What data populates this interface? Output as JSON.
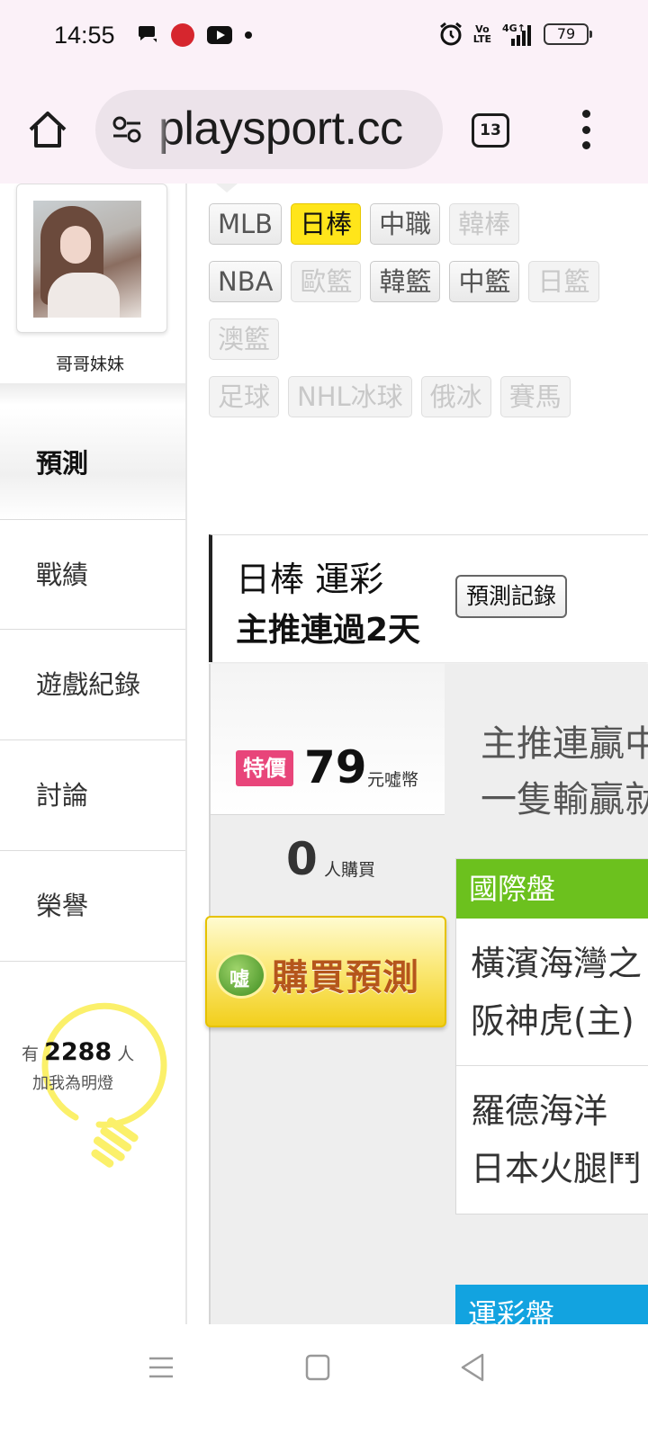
{
  "status_bar": {
    "time": "14:55",
    "battery": "79",
    "left_icons": [
      "chat-icon",
      "app-badge-icon",
      "youtube-icon",
      "notification-dot-icon"
    ],
    "right_icons": [
      "alarm-icon",
      "volte-icon",
      "signal-4g-icon",
      "battery-icon"
    ],
    "volte_top": "Vo",
    "volte_bottom": "LTE"
  },
  "browser": {
    "url": "playsport.cc",
    "tab_count": "13"
  },
  "sidebar": {
    "nickname": "哥哥妹妹",
    "nav": [
      {
        "label": "預測",
        "active": true
      },
      {
        "label": "戰績"
      },
      {
        "label": "遊戲紀錄"
      },
      {
        "label": "討論"
      },
      {
        "label": "榮譽"
      }
    ],
    "fans": {
      "prefix": "有",
      "count": "2288",
      "suffix": "人",
      "line2": "加我為明燈"
    }
  },
  "sport_filter": {
    "rows": [
      [
        {
          "label": "MLB"
        },
        {
          "label": "日棒",
          "selected": true
        },
        {
          "label": "中職"
        },
        {
          "label": "韓棒",
          "disabled": true
        }
      ],
      [
        {
          "label": "NBA"
        },
        {
          "label": "歐籃",
          "disabled": true
        },
        {
          "label": "韓籃"
        },
        {
          "label": "中籃"
        },
        {
          "label": "日籃",
          "disabled": true
        }
      ],
      [
        {
          "label": "澳籃",
          "disabled": true
        }
      ],
      [
        {
          "label": "足球",
          "disabled": true
        },
        {
          "label": "NHL冰球",
          "disabled": true
        },
        {
          "label": "俄冰",
          "disabled": true
        },
        {
          "label": "賽馬",
          "disabled": true
        }
      ]
    ]
  },
  "record_header": {
    "title": "日棒 運彩",
    "streak": "主推連過2天",
    "history_button": "預測記錄"
  },
  "purchase": {
    "special_tag": "特價",
    "price": "79",
    "price_unit": "元噓幣",
    "buyers": "0",
    "buyers_unit": "人購買",
    "buy_button": "購買預測"
  },
  "promo": {
    "line1": "主推連贏中",
    "line2": "一隻輸贏就"
  },
  "markets": [
    {
      "name": "國際盤",
      "color": "#6cc11e",
      "games": [
        {
          "away": "橫濱海灣之",
          "home": "阪神虎(主)"
        },
        {
          "away": "羅德海洋",
          "home": "日本火腿鬥"
        }
      ]
    },
    {
      "name": "運彩盤",
      "color": "#12a3e0",
      "games": []
    }
  ],
  "android_nav": [
    "recents-icon",
    "home-icon",
    "back-icon"
  ]
}
